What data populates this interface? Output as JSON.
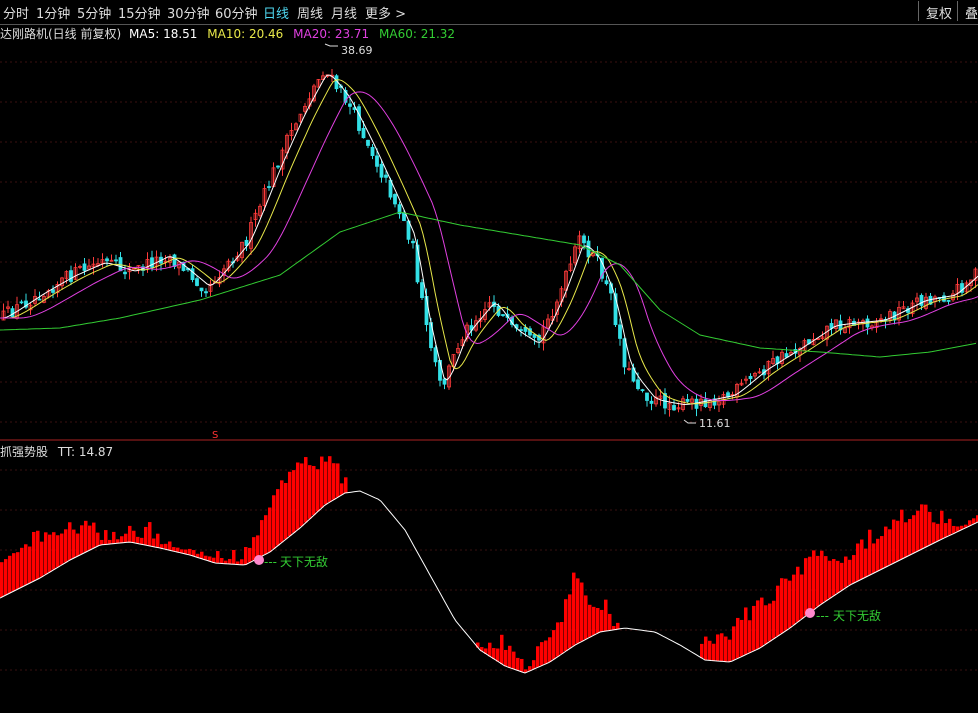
{
  "toolbar": {
    "periods": [
      {
        "label": "分时"
      },
      {
        "label": "1分钟"
      },
      {
        "label": "5分钟"
      },
      {
        "label": "15分钟"
      },
      {
        "label": "30分钟"
      },
      {
        "label": "60分钟"
      },
      {
        "label": "日线"
      },
      {
        "label": "周线"
      },
      {
        "label": "月线"
      },
      {
        "label": "更多 >"
      }
    ],
    "active_period": "日线",
    "fuquan_label": "复权",
    "overlay_label": "叠"
  },
  "main_chart": {
    "title": "达刚路机(日线 前复权)",
    "ma5": {
      "label": "MA5: 18.51",
      "color": "#ffffff"
    },
    "ma10": {
      "label": "MA10: 20.46",
      "color": "#e8e84a"
    },
    "ma20": {
      "label": "MA20: 23.71",
      "color": "#e040e0"
    },
    "ma60": {
      "label": "MA60: 21.32",
      "color": "#33cc33"
    },
    "high_label": "38.69",
    "low_label": "11.61",
    "marker_label": "S",
    "up_color": "#ff3b3b",
    "down_color": "#33e0e6"
  },
  "indicator": {
    "title": "抓强势股",
    "tt_label": "TT: 14.87",
    "signal_label": "天下无敌",
    "bar_color": "#ff0000",
    "line_color": "#ffffff",
    "signal_color": "#33cc33"
  },
  "chart_data": {
    "type": "candlestick",
    "y_range": [
      11.61,
      38.69
    ],
    "high": 38.69,
    "low": 11.61,
    "ma_latest": {
      "MA5": 18.51,
      "MA10": 20.46,
      "MA20": 23.71,
      "MA60": 21.32
    },
    "indicator_latest": {
      "TT": 14.87
    }
  }
}
